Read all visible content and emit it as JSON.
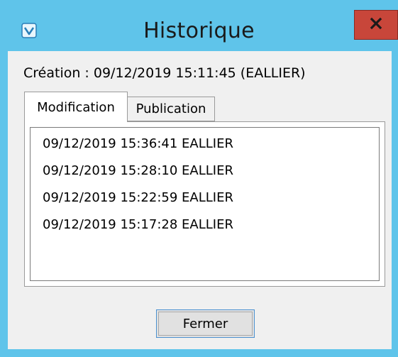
{
  "window": {
    "title": "Historique",
    "accent_color": "#5fc4ea",
    "close_color": "#c8463a"
  },
  "creation": {
    "text": "Création : 09/12/2019 15:11:45 (EALLIER)"
  },
  "tabs": [
    {
      "label": "Modification",
      "selected": true
    },
    {
      "label": "Publication",
      "selected": false
    }
  ],
  "history": {
    "items": [
      "09/12/2019 15:36:41 EALLIER",
      "09/12/2019 15:28:10 EALLIER",
      "09/12/2019 15:22:59 EALLIER",
      "09/12/2019 15:17:28 EALLIER"
    ]
  },
  "buttons": {
    "close_label": "Fermer"
  },
  "icons": {
    "app": "app-logo-icon",
    "close": "close-icon"
  }
}
